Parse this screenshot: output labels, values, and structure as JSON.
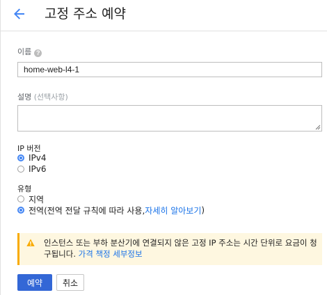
{
  "header": {
    "title": "고정 주소 예약",
    "back_icon": "arrow-back-icon"
  },
  "form": {
    "name": {
      "label": "이름",
      "value": "home-web-l4-1",
      "help_icon": "help-icon"
    },
    "description": {
      "label": "설명",
      "optional_label": "(선택사항)",
      "value": ""
    },
    "ip_version": {
      "label": "IP 버전",
      "options": [
        {
          "label": "IPv4",
          "selected": true
        },
        {
          "label": "IPv6",
          "selected": false
        }
      ]
    },
    "type": {
      "label": "유형",
      "options": [
        {
          "label": "지역",
          "selected": false
        },
        {
          "label": "전역(전역 전달 규칙에 따라 사용, ",
          "link": "자세히 알아보기",
          "suffix": ")",
          "selected": true
        }
      ]
    }
  },
  "notice": {
    "icon": "warning-icon",
    "text": "인스턴스 또는 부하 분산기에 연결되지 않은 고정 IP 주소는 시간 단위로 요금이 청구됩니다. ",
    "link": "가격 책정 세부정보",
    "accent_color": "#f9ab00",
    "background_color": "#fef7e0"
  },
  "actions": {
    "reserve_label": "예약",
    "cancel_label": "취소"
  },
  "colors": {
    "primary": "#3367d6",
    "accent_blue": "#4285f4",
    "link": "#1a73e8"
  }
}
